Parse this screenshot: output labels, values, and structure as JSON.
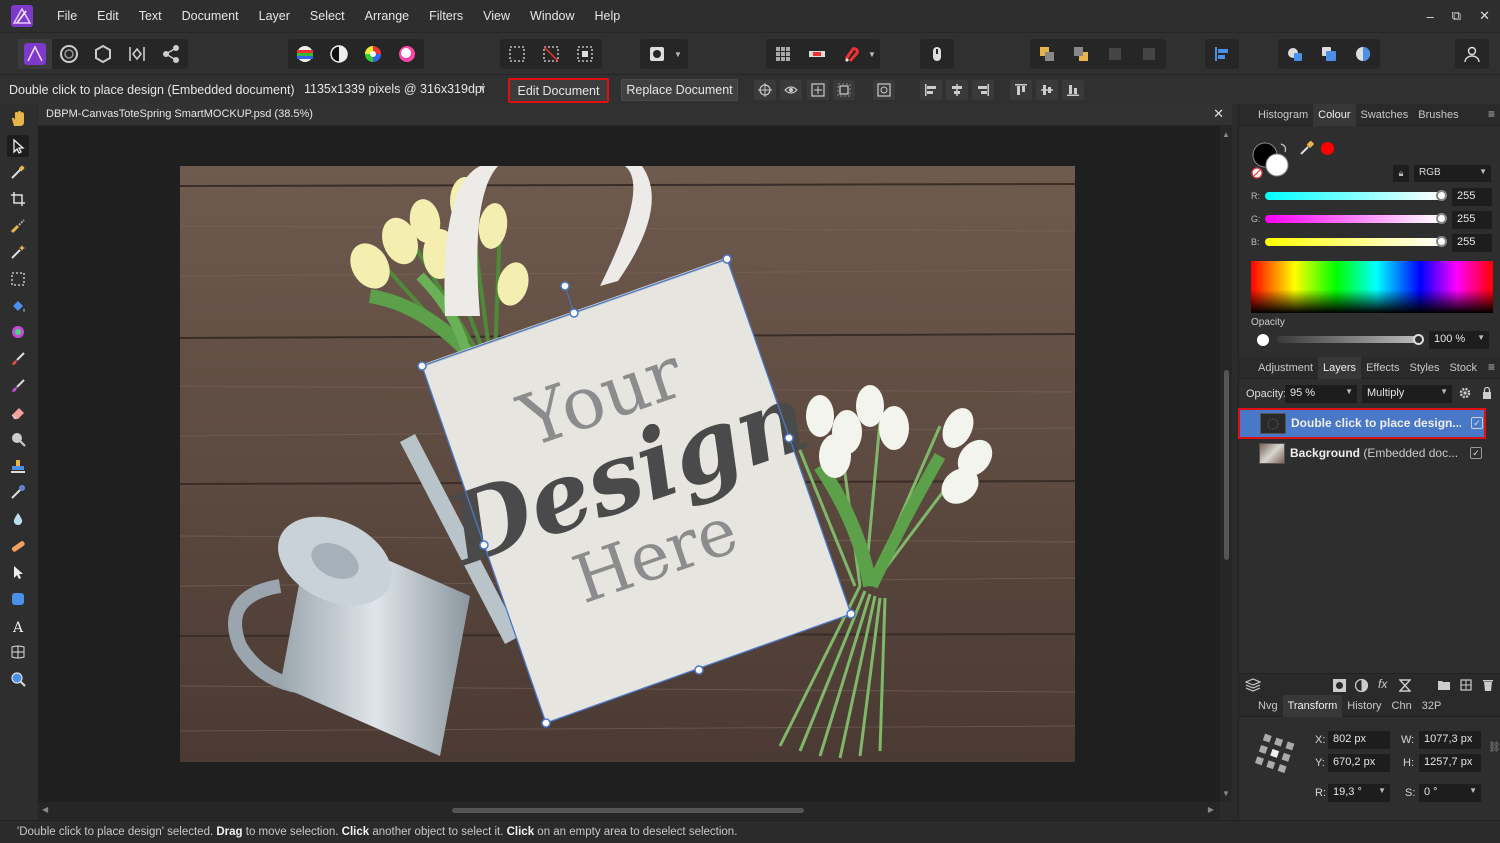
{
  "menu": [
    "File",
    "Edit",
    "Text",
    "Document",
    "Layer",
    "Select",
    "Arrange",
    "Filters",
    "View",
    "Window",
    "Help"
  ],
  "window_controls": {
    "minimize": "–",
    "restore": "⧉",
    "close": "✕"
  },
  "context_bar": {
    "hint": "Double click to place design (Embedded document)",
    "size_info": "1135x1339 pixels @ 316x319dpi",
    "edit_document": "Edit Document",
    "replace_document": "Replace Document"
  },
  "document": {
    "tab_title": "DBPM-CanvasToteSpring SmartMOCKUP.psd (38.5%)",
    "close": "✕",
    "bag_text": [
      "Your",
      "Design",
      "Here"
    ]
  },
  "colour_panel": {
    "tabs": [
      "Histogram",
      "Colour",
      "Swatches",
      "Brushes"
    ],
    "active_tab": "Colour",
    "mode": "RGB",
    "channels": [
      {
        "label": "R:",
        "value": "255"
      },
      {
        "label": "G:",
        "value": "255"
      },
      {
        "label": "B:",
        "value": "255"
      }
    ],
    "opacity_label": "Opacity",
    "opacity_value": "100 %",
    "colors": {
      "fill": "#ffffff",
      "stroke": "#000000",
      "picked": "#ff0000"
    }
  },
  "layers_panel": {
    "tabs": [
      "Adjustment",
      "Layers",
      "Effects",
      "Styles",
      "Stock"
    ],
    "active_tab": "Layers",
    "opacity_label": "Opacity:",
    "opacity_value": "95 %",
    "blend_mode": "Multiply",
    "layers": [
      {
        "name": "Double click to place design...",
        "suffix": "",
        "selected": true,
        "visible": true
      },
      {
        "name": "Background",
        "suffix": " (Embedded doc...",
        "selected": false,
        "visible": true
      }
    ]
  },
  "transform_panel": {
    "tabs": [
      "Nvg",
      "Transform",
      "History",
      "Chn",
      "32P"
    ],
    "active_tab": "Transform",
    "x": {
      "label": "X:",
      "value": "802 px"
    },
    "y": {
      "label": "Y:",
      "value": "670,2 px"
    },
    "w": {
      "label": "W:",
      "value": "1077,3 px"
    },
    "h": {
      "label": "H:",
      "value": "1257,7 px"
    },
    "r": {
      "label": "R:",
      "value": "19,3 °"
    },
    "s": {
      "label": "S:",
      "value": "0 °"
    }
  },
  "status_bar": {
    "part1": "'Double click to place design' selected. ",
    "drag": "Drag",
    "part2": " to move selection. ",
    "click": "Click",
    "part3": " another object to select it. ",
    "click2": "Click",
    "part4": " on an empty area to deselect selection."
  },
  "accent_colors": {
    "selection": "#4a78c8",
    "highlight": "#e01010",
    "app": "#8a3ec8"
  }
}
